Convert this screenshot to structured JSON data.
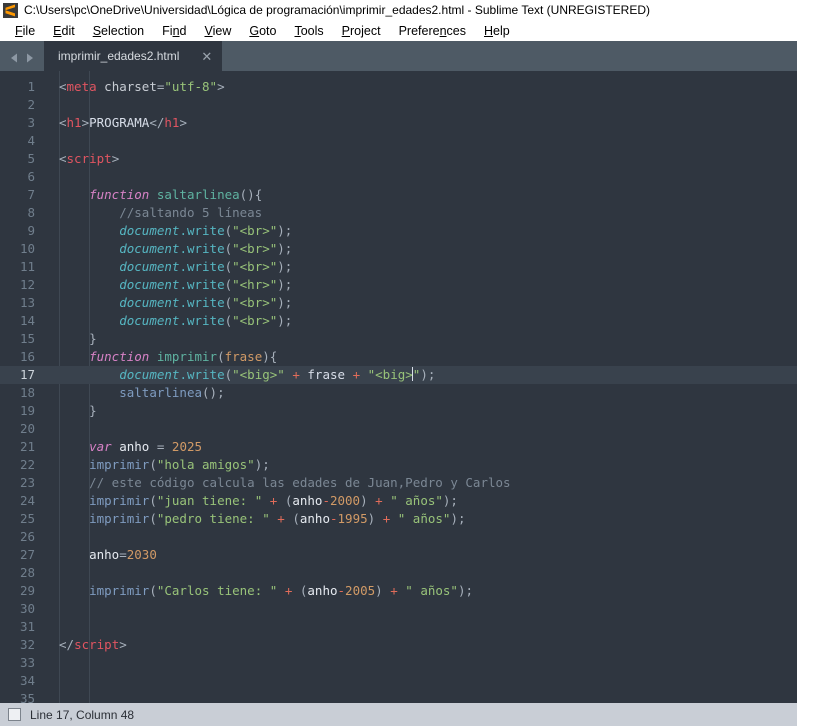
{
  "window": {
    "title": "C:\\Users\\pc\\OneDrive\\Universidad\\Lógica de programación\\imprimir_edades2.html - Sublime Text (UNREGISTERED)",
    "app_icon": "sublime-text-logo-icon"
  },
  "menubar": {
    "items": [
      {
        "label": "File",
        "mnemonic": "F"
      },
      {
        "label": "Edit",
        "mnemonic": "E"
      },
      {
        "label": "Selection",
        "mnemonic": "S"
      },
      {
        "label": "Find",
        "mnemonic": "n"
      },
      {
        "label": "View",
        "mnemonic": "V"
      },
      {
        "label": "Goto",
        "mnemonic": "G"
      },
      {
        "label": "Tools",
        "mnemonic": "T"
      },
      {
        "label": "Project",
        "mnemonic": "P"
      },
      {
        "label": "Preferences",
        "mnemonic": "n"
      },
      {
        "label": "Help",
        "mnemonic": "H"
      }
    ]
  },
  "tabbar": {
    "prev_arrow": "◀",
    "next_arrow": "▶",
    "tabs": [
      {
        "label": "imprimir_edades2.html",
        "close": "✕",
        "active": true
      }
    ]
  },
  "statusbar": {
    "text": "Line 17, Column 48"
  },
  "editor": {
    "active_line": 17,
    "cursor_column": 48,
    "lines": [
      {
        "n": "1",
        "tokens": [
          {
            "t": "punct",
            "v": "<"
          },
          {
            "t": "tag",
            "v": "meta"
          },
          {
            "t": "text",
            "v": " "
          },
          {
            "t": "attr",
            "v": "charset"
          },
          {
            "t": "eq",
            "v": "="
          },
          {
            "t": "str",
            "v": "\"utf-8\""
          },
          {
            "t": "punct",
            "v": ">"
          }
        ]
      },
      {
        "n": "2",
        "tokens": []
      },
      {
        "n": "3",
        "tokens": [
          {
            "t": "punct",
            "v": "<"
          },
          {
            "t": "tag",
            "v": "h1"
          },
          {
            "t": "punct",
            "v": ">"
          },
          {
            "t": "text",
            "v": "PROGRAMA"
          },
          {
            "t": "punct",
            "v": "</"
          },
          {
            "t": "tag",
            "v": "h1"
          },
          {
            "t": "punct",
            "v": ">"
          }
        ]
      },
      {
        "n": "4",
        "tokens": []
      },
      {
        "n": "5",
        "tokens": [
          {
            "t": "punct",
            "v": "<"
          },
          {
            "t": "tag",
            "v": "script"
          },
          {
            "t": "punct",
            "v": ">"
          }
        ]
      },
      {
        "n": "6",
        "tokens": []
      },
      {
        "n": "7",
        "tokens": [
          {
            "t": "text",
            "v": "    "
          },
          {
            "t": "kw",
            "v": "function"
          },
          {
            "t": "text",
            "v": " "
          },
          {
            "t": "fnname",
            "v": "saltarlinea"
          },
          {
            "t": "punct",
            "v": "(){"
          }
        ]
      },
      {
        "n": "8",
        "tokens": [
          {
            "t": "text",
            "v": "        "
          },
          {
            "t": "comment",
            "v": "//saltando 5 líneas"
          }
        ]
      },
      {
        "n": "9",
        "tokens": [
          {
            "t": "text",
            "v": "        "
          },
          {
            "t": "obj",
            "v": "document"
          },
          {
            "t": "meth",
            "v": ".write"
          },
          {
            "t": "punct",
            "v": "("
          },
          {
            "t": "str",
            "v": "\"<br>\""
          },
          {
            "t": "punct",
            "v": ");"
          }
        ]
      },
      {
        "n": "10",
        "tokens": [
          {
            "t": "text",
            "v": "        "
          },
          {
            "t": "obj",
            "v": "document"
          },
          {
            "t": "meth",
            "v": ".write"
          },
          {
            "t": "punct",
            "v": "("
          },
          {
            "t": "str",
            "v": "\"<br>\""
          },
          {
            "t": "punct",
            "v": ");"
          }
        ]
      },
      {
        "n": "11",
        "tokens": [
          {
            "t": "text",
            "v": "        "
          },
          {
            "t": "obj",
            "v": "document"
          },
          {
            "t": "meth",
            "v": ".write"
          },
          {
            "t": "punct",
            "v": "("
          },
          {
            "t": "str",
            "v": "\"<br>\""
          },
          {
            "t": "punct",
            "v": ");"
          }
        ]
      },
      {
        "n": "12",
        "tokens": [
          {
            "t": "text",
            "v": "        "
          },
          {
            "t": "obj",
            "v": "document"
          },
          {
            "t": "meth",
            "v": ".write"
          },
          {
            "t": "punct",
            "v": "("
          },
          {
            "t": "str",
            "v": "\"<hr>\""
          },
          {
            "t": "punct",
            "v": ");"
          }
        ]
      },
      {
        "n": "13",
        "tokens": [
          {
            "t": "text",
            "v": "        "
          },
          {
            "t": "obj",
            "v": "document"
          },
          {
            "t": "meth",
            "v": ".write"
          },
          {
            "t": "punct",
            "v": "("
          },
          {
            "t": "str",
            "v": "\"<br>\""
          },
          {
            "t": "punct",
            "v": ");"
          }
        ]
      },
      {
        "n": "14",
        "tokens": [
          {
            "t": "text",
            "v": "        "
          },
          {
            "t": "obj",
            "v": "document"
          },
          {
            "t": "meth",
            "v": ".write"
          },
          {
            "t": "punct",
            "v": "("
          },
          {
            "t": "str",
            "v": "\"<br>\""
          },
          {
            "t": "punct",
            "v": ");"
          }
        ]
      },
      {
        "n": "15",
        "tokens": [
          {
            "t": "text",
            "v": "    "
          },
          {
            "t": "punct",
            "v": "}"
          }
        ]
      },
      {
        "n": "16",
        "tokens": [
          {
            "t": "text",
            "v": "    "
          },
          {
            "t": "kw",
            "v": "function"
          },
          {
            "t": "text",
            "v": " "
          },
          {
            "t": "fnname",
            "v": "imprimir"
          },
          {
            "t": "punct",
            "v": "("
          },
          {
            "t": "param",
            "v": "frase"
          },
          {
            "t": "punct",
            "v": "){"
          }
        ]
      },
      {
        "n": "17",
        "tokens": [
          {
            "t": "text",
            "v": "        "
          },
          {
            "t": "obj",
            "v": "document"
          },
          {
            "t": "meth",
            "v": ".write"
          },
          {
            "t": "punct",
            "v": "("
          },
          {
            "t": "str",
            "v": "\"<big>\""
          },
          {
            "t": "text",
            "v": " "
          },
          {
            "t": "op",
            "v": "+"
          },
          {
            "t": "text",
            "v": " frase "
          },
          {
            "t": "op",
            "v": "+"
          },
          {
            "t": "text",
            "v": " "
          },
          {
            "t": "str",
            "v": "\"<big>"
          },
          {
            "t": "cursor",
            "v": ""
          },
          {
            "t": "str",
            "v": "\""
          },
          {
            "t": "punct",
            "v": ");"
          }
        ]
      },
      {
        "n": "18",
        "tokens": [
          {
            "t": "text",
            "v": "        "
          },
          {
            "t": "call",
            "v": "saltarlinea"
          },
          {
            "t": "punct",
            "v": "();"
          }
        ]
      },
      {
        "n": "19",
        "tokens": [
          {
            "t": "text",
            "v": "    "
          },
          {
            "t": "punct",
            "v": "}"
          }
        ]
      },
      {
        "n": "20",
        "tokens": []
      },
      {
        "n": "21",
        "tokens": [
          {
            "t": "text",
            "v": "    "
          },
          {
            "t": "kw",
            "v": "var"
          },
          {
            "t": "text",
            "v": " "
          },
          {
            "t": "var",
            "v": "anho"
          },
          {
            "t": "text",
            "v": " "
          },
          {
            "t": "eq",
            "v": "="
          },
          {
            "t": "text",
            "v": " "
          },
          {
            "t": "num",
            "v": "2025"
          }
        ]
      },
      {
        "n": "22",
        "tokens": [
          {
            "t": "text",
            "v": "    "
          },
          {
            "t": "call",
            "v": "imprimir"
          },
          {
            "t": "punct",
            "v": "("
          },
          {
            "t": "str",
            "v": "\"hola amigos\""
          },
          {
            "t": "punct",
            "v": ");"
          }
        ]
      },
      {
        "n": "23",
        "tokens": [
          {
            "t": "text",
            "v": "    "
          },
          {
            "t": "comment",
            "v": "// este código calcula las edades de Juan,Pedro y Carlos"
          }
        ]
      },
      {
        "n": "24",
        "tokens": [
          {
            "t": "text",
            "v": "    "
          },
          {
            "t": "call",
            "v": "imprimir"
          },
          {
            "t": "punct",
            "v": "("
          },
          {
            "t": "str",
            "v": "\"juan tiene: \""
          },
          {
            "t": "text",
            "v": " "
          },
          {
            "t": "op",
            "v": "+"
          },
          {
            "t": "text",
            "v": " "
          },
          {
            "t": "punct",
            "v": "("
          },
          {
            "t": "var",
            "v": "anho"
          },
          {
            "t": "op",
            "v": "-"
          },
          {
            "t": "num",
            "v": "2000"
          },
          {
            "t": "punct",
            "v": ")"
          },
          {
            "t": "text",
            "v": " "
          },
          {
            "t": "op",
            "v": "+"
          },
          {
            "t": "text",
            "v": " "
          },
          {
            "t": "str",
            "v": "\" años\""
          },
          {
            "t": "punct",
            "v": ");"
          }
        ]
      },
      {
        "n": "25",
        "tokens": [
          {
            "t": "text",
            "v": "    "
          },
          {
            "t": "call",
            "v": "imprimir"
          },
          {
            "t": "punct",
            "v": "("
          },
          {
            "t": "str",
            "v": "\"pedro tiene: \""
          },
          {
            "t": "text",
            "v": " "
          },
          {
            "t": "op",
            "v": "+"
          },
          {
            "t": "text",
            "v": " "
          },
          {
            "t": "punct",
            "v": "("
          },
          {
            "t": "var",
            "v": "anho"
          },
          {
            "t": "op",
            "v": "-"
          },
          {
            "t": "num",
            "v": "1995"
          },
          {
            "t": "punct",
            "v": ")"
          },
          {
            "t": "text",
            "v": " "
          },
          {
            "t": "op",
            "v": "+"
          },
          {
            "t": "text",
            "v": " "
          },
          {
            "t": "str",
            "v": "\" años\""
          },
          {
            "t": "punct",
            "v": ");"
          }
        ]
      },
      {
        "n": "26",
        "tokens": []
      },
      {
        "n": "27",
        "tokens": [
          {
            "t": "text",
            "v": "    "
          },
          {
            "t": "var",
            "v": "anho"
          },
          {
            "t": "eq",
            "v": "="
          },
          {
            "t": "num",
            "v": "2030"
          }
        ]
      },
      {
        "n": "28",
        "tokens": []
      },
      {
        "n": "29",
        "tokens": [
          {
            "t": "text",
            "v": "    "
          },
          {
            "t": "call",
            "v": "imprimir"
          },
          {
            "t": "punct",
            "v": "("
          },
          {
            "t": "str",
            "v": "\"Carlos tiene: \""
          },
          {
            "t": "text",
            "v": " "
          },
          {
            "t": "op",
            "v": "+"
          },
          {
            "t": "text",
            "v": " "
          },
          {
            "t": "punct",
            "v": "("
          },
          {
            "t": "var",
            "v": "anho"
          },
          {
            "t": "op",
            "v": "-"
          },
          {
            "t": "num",
            "v": "2005"
          },
          {
            "t": "punct",
            "v": ")"
          },
          {
            "t": "text",
            "v": " "
          },
          {
            "t": "op",
            "v": "+"
          },
          {
            "t": "text",
            "v": " "
          },
          {
            "t": "str",
            "v": "\" años\""
          },
          {
            "t": "punct",
            "v": ");"
          }
        ]
      },
      {
        "n": "30",
        "tokens": []
      },
      {
        "n": "31",
        "tokens": []
      },
      {
        "n": "32",
        "tokens": [
          {
            "t": "punct",
            "v": "</"
          },
          {
            "t": "tag",
            "v": "script"
          },
          {
            "t": "punct",
            "v": ">"
          }
        ]
      },
      {
        "n": "33",
        "tokens": []
      },
      {
        "n": "34",
        "tokens": []
      },
      {
        "n": "35",
        "tokens": []
      }
    ]
  },
  "colors": {
    "titlebar_bg": "#ffffff",
    "tabbar_bg": "#4e5a65",
    "tab_active_bg": "#2f3640",
    "editor_bg": "#2f3640",
    "active_line_bg": "#39424d",
    "statusbar_bg": "#c9ced6",
    "gutter_text": "#707e8c",
    "tag": "#e05561",
    "string": "#98c379",
    "keyword": "#d782c6",
    "function_name": "#5fb3a1",
    "object": "#56b6c2",
    "comment": "#7b8794",
    "number": "#d19a66",
    "operator": "#e06c5a",
    "call": "#7f9cc0"
  }
}
